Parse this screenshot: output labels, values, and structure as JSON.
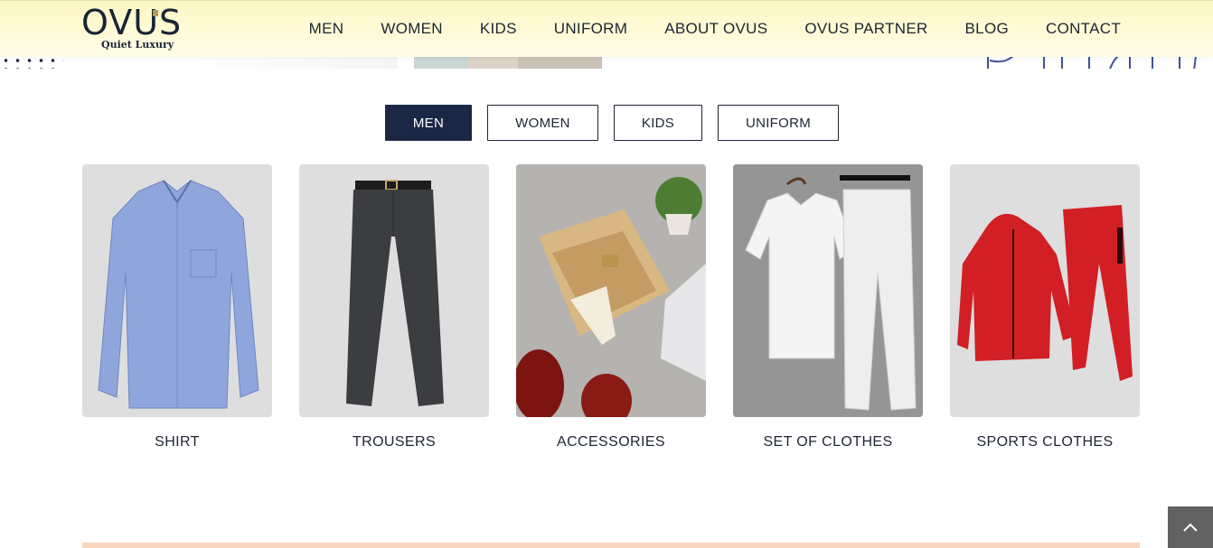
{
  "brand": {
    "logo": "OVUS",
    "tagline": "Quiet Luxury"
  },
  "nav": [
    "MEN",
    "WOMEN",
    "KIDS",
    "UNIFORM",
    "ABOUT OVUS",
    "OVUS PARTNER",
    "BLOG",
    "CONTACT"
  ],
  "tabs": {
    "active": "MEN",
    "items": [
      "MEN",
      "WOMEN",
      "KIDS",
      "UNIFORM"
    ]
  },
  "products": [
    {
      "label": "SHIRT",
      "icon": "shirt-image"
    },
    {
      "label": "TROUSERS",
      "icon": "trousers-image"
    },
    {
      "label": "ACCESSORIES",
      "icon": "accessories-image"
    },
    {
      "label": "SET OF CLOTHES",
      "icon": "set-of-clothes-image"
    },
    {
      "label": "SPORTS CLOTHES",
      "icon": "sports-clothes-image"
    }
  ],
  "colors": {
    "header_bg": "#fdf7c3",
    "active_tab": "#1b2744",
    "text": "#1d2433",
    "back_to_top": "#626262"
  }
}
